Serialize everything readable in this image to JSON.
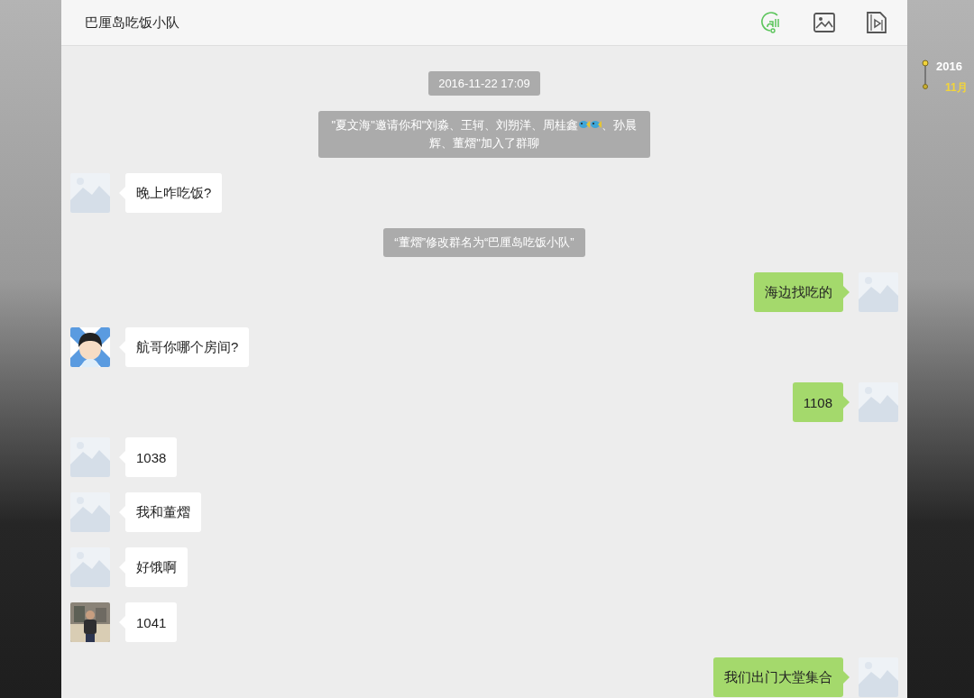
{
  "chat": {
    "title": "巴厘岛吃饭小队"
  },
  "timeline": {
    "year": "2016",
    "month": "11月"
  },
  "messages": [
    {
      "kind": "time",
      "text": "2016-11-22 17:09"
    },
    {
      "kind": "system",
      "parts": [
        {
          "kind": "text",
          "text": "\"夏文海\"邀请你和\"刘淼、王轲、刘朔洋、周桂鑫"
        },
        {
          "kind": "fish"
        },
        {
          "kind": "fish"
        },
        {
          "kind": "text",
          "text": "、孙晨辉、董熠\"加入了群聊"
        }
      ]
    },
    {
      "kind": "incoming",
      "avatar": {
        "kind": "placeholder"
      },
      "text": "晚上咋吃饭?"
    },
    {
      "kind": "system",
      "parts": [
        {
          "kind": "text",
          "text": "“董熠”修改群名为“巴厘岛吃饭小队”"
        }
      ]
    },
    {
      "kind": "outgoing",
      "avatar": {
        "kind": "placeholder"
      },
      "text": "海边找吃的"
    },
    {
      "kind": "incoming",
      "avatar": {
        "kind": "cartoon"
      },
      "text": "航哥你哪个房间?"
    },
    {
      "kind": "outgoing",
      "avatar": {
        "kind": "placeholder"
      },
      "text": "1108"
    },
    {
      "kind": "incoming",
      "avatar": {
        "kind": "placeholder"
      },
      "text": "1038"
    },
    {
      "kind": "incoming",
      "avatar": {
        "kind": "placeholder"
      },
      "text": "我和董熠"
    },
    {
      "kind": "incoming",
      "avatar": {
        "kind": "placeholder"
      },
      "text": "好饿啊"
    },
    {
      "kind": "incoming",
      "text": "1041"
    },
    {
      "kind": "outgoing",
      "avatar": {
        "kind": "placeholder"
      },
      "text": "我们出门大堂集合"
    }
  ]
}
